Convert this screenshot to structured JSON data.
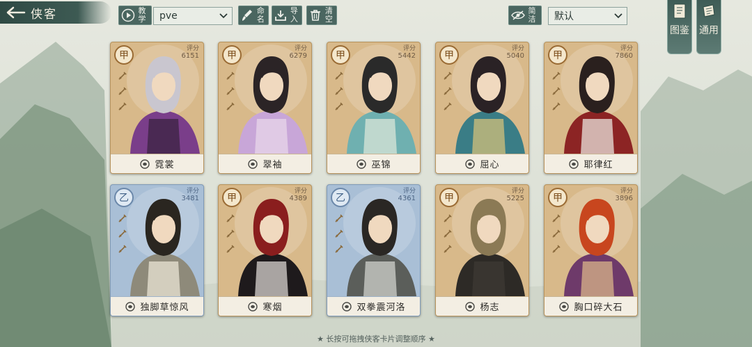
{
  "header": {
    "title": "侠客",
    "tutorial_label": "教学",
    "mode_select_value": "pve",
    "rename_label": "命名",
    "import_label": "导入",
    "clear_label": "清空",
    "simple_label": "简洁",
    "sort_select_value": "默认",
    "atlas_label": "图鉴",
    "general_label": "通用"
  },
  "cards": [
    {
      "tier": "甲",
      "score_label": "评分",
      "score": "6151",
      "name": "霓裳",
      "tier_class": "tierA"
    },
    {
      "tier": "甲",
      "score_label": "评分",
      "score": "6279",
      "name": "翠袖",
      "tier_class": "tierA"
    },
    {
      "tier": "甲",
      "score_label": "评分",
      "score": "5442",
      "name": "巫锦",
      "tier_class": "tierA"
    },
    {
      "tier": "甲",
      "score_label": "评分",
      "score": "5040",
      "name": "屈心",
      "tier_class": "tierA"
    },
    {
      "tier": "甲",
      "score_label": "评分",
      "score": "7860",
      "name": "耶律红",
      "tier_class": "tierA"
    },
    {
      "tier": "乙",
      "score_label": "评分",
      "score": "3481",
      "name": "独脚草惊风",
      "tier_class": "tierB"
    },
    {
      "tier": "甲",
      "score_label": "评分",
      "score": "4389",
      "name": "寒烟",
      "tier_class": "tierA"
    },
    {
      "tier": "乙",
      "score_label": "评分",
      "score": "4361",
      "name": "双拳震河洛",
      "tier_class": "tierB"
    },
    {
      "tier": "甲",
      "score_label": "评分",
      "score": "5225",
      "name": "杨志",
      "tier_class": "tierA"
    },
    {
      "tier": "甲",
      "score_label": "评分",
      "score": "3896",
      "name": "胸口碎大石",
      "tier_class": "tierA"
    }
  ],
  "footer": {
    "hint": "★ 长按可拖拽侠客卡片调整顺序 ★"
  }
}
